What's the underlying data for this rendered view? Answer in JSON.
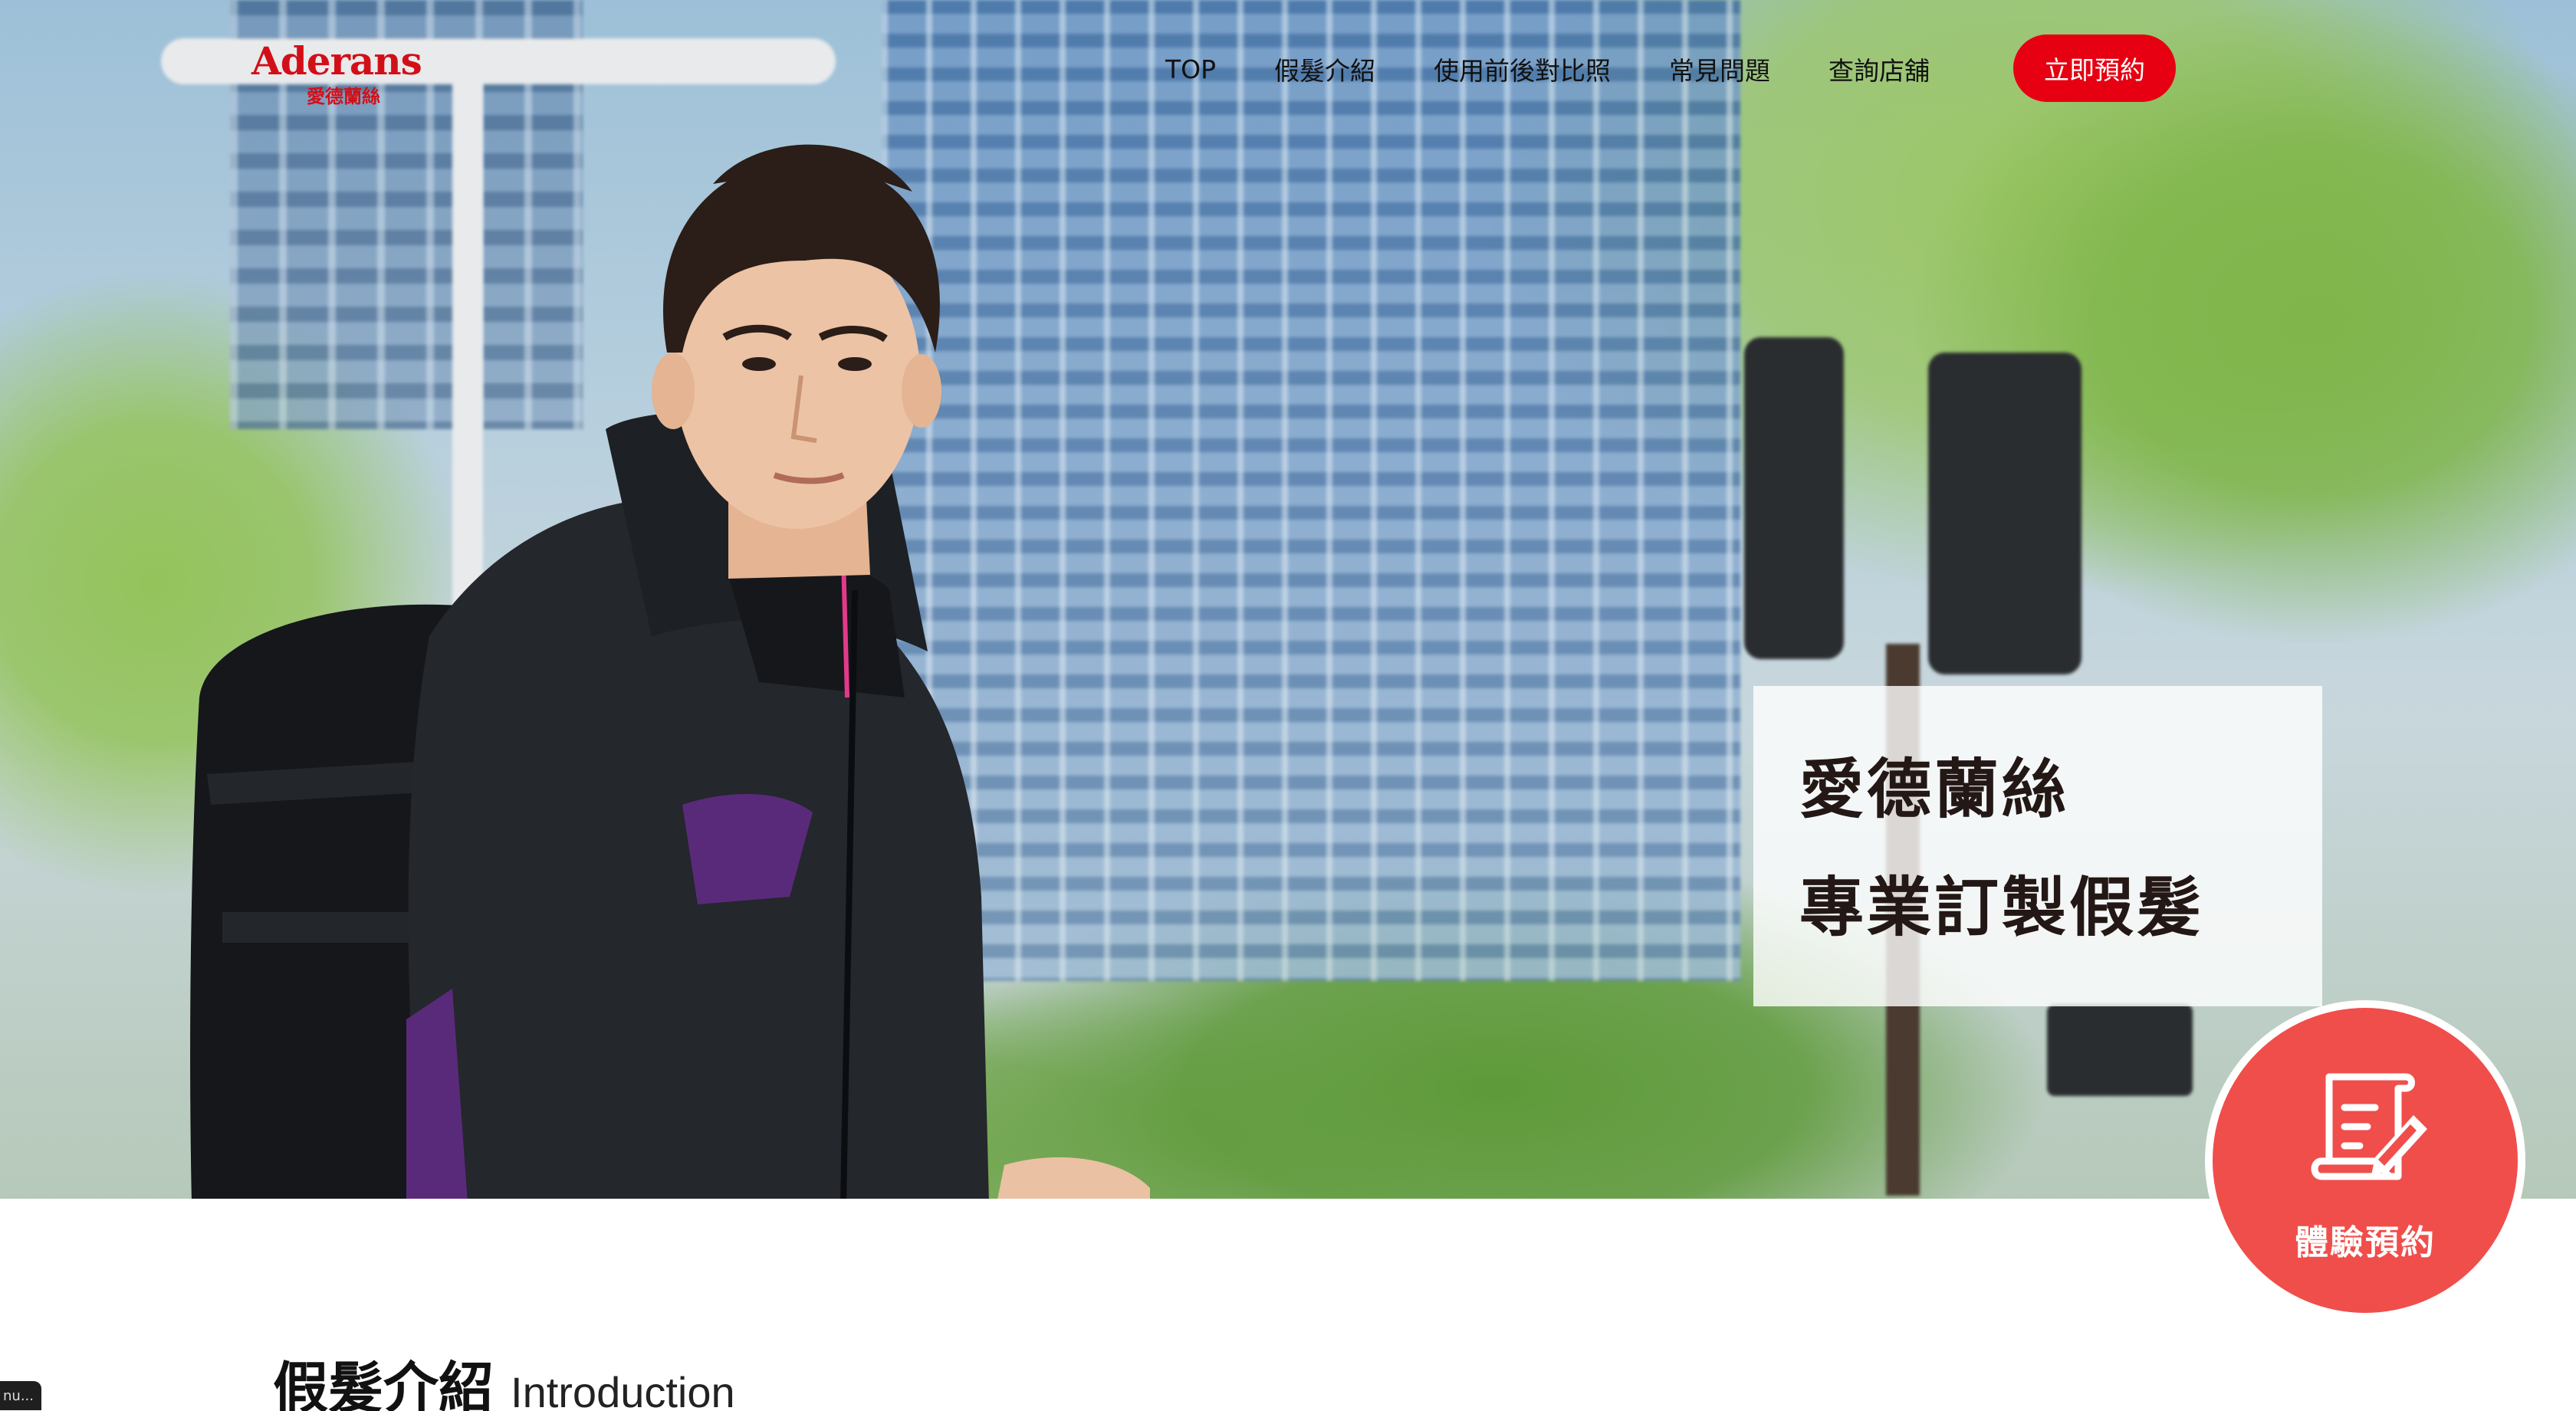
{
  "brand": {
    "name": "Aderans",
    "sub": "愛德蘭絲",
    "color": "#d20f18"
  },
  "nav": {
    "items": [
      "TOP",
      "假髮介紹",
      "使用前後對比照",
      "常見問題",
      "查詢店舖"
    ],
    "cta": "立即預約",
    "cta_color": "#e60012"
  },
  "hero": {
    "tagline_line1": "愛德蘭絲",
    "tagline_line2": "專業訂製假髮"
  },
  "badge": {
    "label": "體驗預約",
    "icon": "document-pen-icon",
    "color": "#f04e4b"
  },
  "section": {
    "title_zh": "假髮介紹",
    "title_en": "Introduction"
  },
  "status": {
    "text": "nu..."
  }
}
